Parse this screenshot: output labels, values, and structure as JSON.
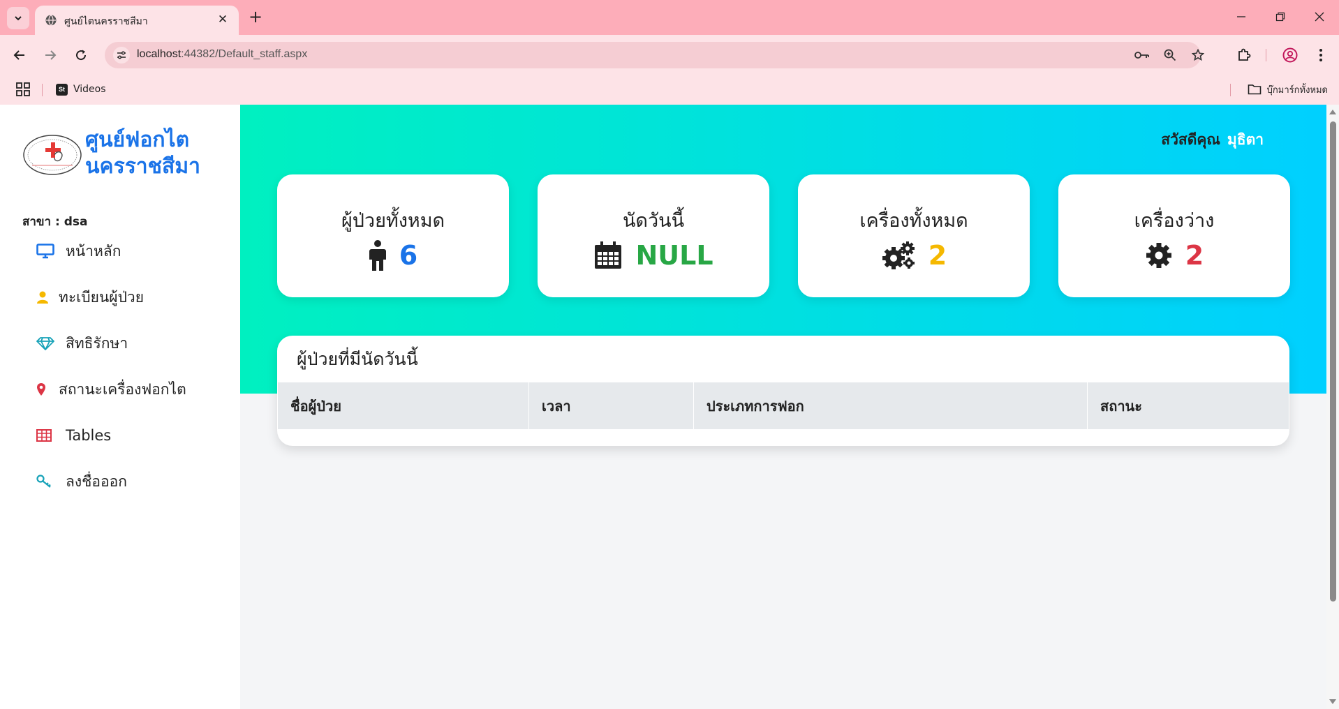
{
  "browser": {
    "tab_title": "ศูนย์ไตนครราชสีมา",
    "url_host": "localhost",
    "url_path": ":44382/Default_staff.aspx",
    "bookmarks": [
      {
        "label": "Videos"
      }
    ],
    "all_bookmarks_label": "บุ๊กมาร์กทั้งหมด"
  },
  "sidebar": {
    "brand_line1": "ศูนย์ฟอกไต",
    "brand_line2": "นครราชสีมา",
    "branch_label": "สาขา : dsa",
    "items": [
      {
        "label": "หน้าหลัก",
        "icon": "desktop-icon"
      },
      {
        "label": "ทะเบียนผู้ป่วย",
        "icon": "user-icon"
      },
      {
        "label": "สิทธิรักษา",
        "icon": "diamond-icon"
      },
      {
        "label": "สถานะเครื่องฟอกไต",
        "icon": "map-marker-icon"
      },
      {
        "label": "Tables",
        "icon": "table-icon"
      },
      {
        "label": "ลงชื่อออก",
        "icon": "key-icon"
      }
    ]
  },
  "header": {
    "greeting": "สวัสดีคุณ",
    "username": "มุธิตา"
  },
  "cards": [
    {
      "label": "ผู้ป่วยทั้งหมด",
      "value": "6",
      "icon": "male-icon",
      "color": "#1a73e8"
    },
    {
      "label": "นัดวันนี้",
      "value": "NULL",
      "icon": "calendar-icon",
      "color": "#28a745"
    },
    {
      "label": "เครื่องทั้งหมด",
      "value": "2",
      "icon": "cogs-icon",
      "color": "#f5b800"
    },
    {
      "label": "เครื่องว่าง",
      "value": "2",
      "icon": "cog-icon",
      "color": "#dc3545"
    }
  ],
  "appointments": {
    "title": "ผู้ป่วยที่มีนัดวันนี้",
    "columns": [
      "ชื่อผู้ป่วย",
      "เวลา",
      "ประเภทการฟอก",
      "สถานะ"
    ],
    "rows": []
  }
}
